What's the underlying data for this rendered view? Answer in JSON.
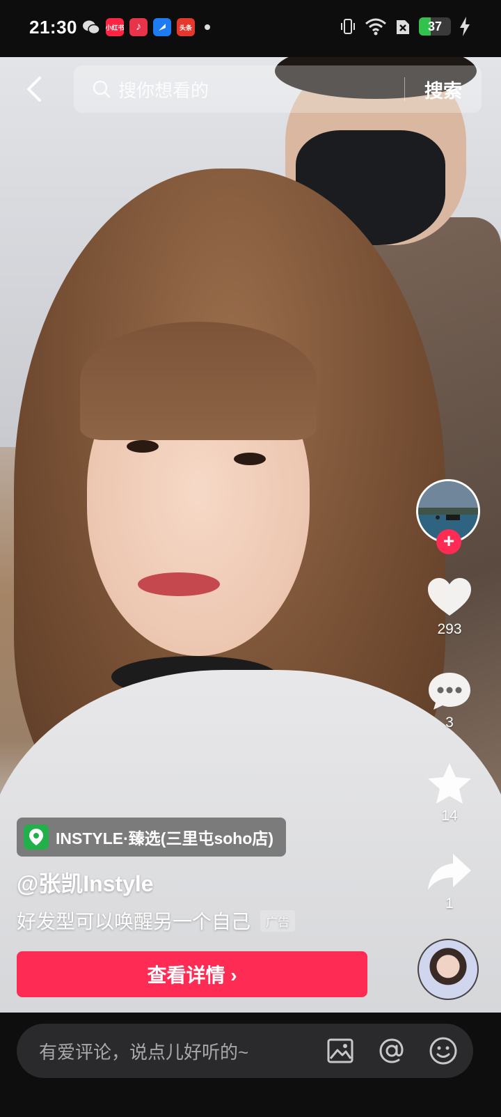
{
  "status_bar": {
    "time": "21:30",
    "apps": [
      {
        "name": "xiaohongshu",
        "label": "小红书",
        "color": "#ff2442"
      },
      {
        "name": "netease-music",
        "label": "♪",
        "color": "#e8334a"
      },
      {
        "name": "blue-app",
        "label": "",
        "color": "#1e7cf2"
      },
      {
        "name": "toutiao",
        "label": "头条",
        "color": "#e6372c"
      }
    ],
    "battery_level": 37,
    "battery_label": "37"
  },
  "search": {
    "placeholder": "搜你想看的",
    "button_label": "搜索"
  },
  "actions": {
    "likes": "293",
    "comments": "3",
    "favorites": "14",
    "shares": "1"
  },
  "location": {
    "label": "INSTYLE·臻选(三里屯soho店)"
  },
  "author": {
    "name": "@张凯Instyle"
  },
  "caption": {
    "text": "好发型可以唤醒另一个自己",
    "ad_label": "广告"
  },
  "cta": {
    "label": "查看详情 ›"
  },
  "comment_bar": {
    "placeholder": "有爱评论，说点儿好听的~"
  },
  "colors": {
    "accent": "#fe2c55",
    "location_green": "#21b04a",
    "battery_green": "#33c24d"
  }
}
